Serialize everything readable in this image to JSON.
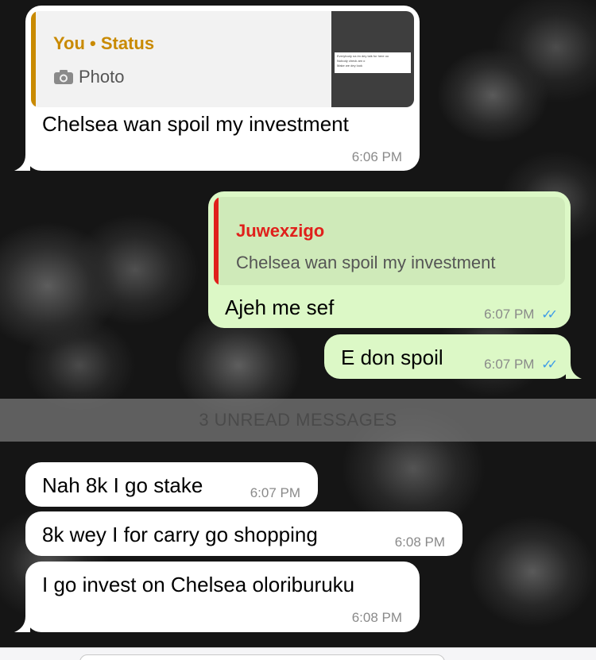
{
  "messages": {
    "m1": {
      "reply_author": "You • Status",
      "reply_media_label": "Photo",
      "thumbnail_lines": [
        "Everybody na im dey talk for here oo",
        "Nobody check am o",
        "Make we dey look"
      ],
      "text": "Chelsea wan spoil my investment",
      "time": "6:06 PM"
    },
    "m2": {
      "reply_author": "Juwexzigo",
      "reply_text": "Chelsea wan spoil my investment",
      "text": "Ajeh me sef",
      "time": "6:07 PM"
    },
    "m3": {
      "text": "E don spoil",
      "time": "6:07 PM"
    },
    "unread_label": "3 UNREAD MESSAGES",
    "m4": {
      "text": "Nah 8k I go stake",
      "time": "6:07 PM"
    },
    "m5": {
      "text": "8k wey I for carry go shopping",
      "time": "6:08 PM"
    },
    "m6": {
      "text": "I go invest on Chelsea oloriburuku",
      "time": "6:08 PM"
    }
  },
  "colors": {
    "incoming_bubble": "#ffffff",
    "outgoing_bubble": "#dcf8c6",
    "status_author": "#c98a00",
    "reply_author_red": "#e0201b",
    "read_ticks": "#3d9be9"
  },
  "icons": {
    "camera": "camera-icon",
    "read_receipt": "double-check-icon"
  }
}
